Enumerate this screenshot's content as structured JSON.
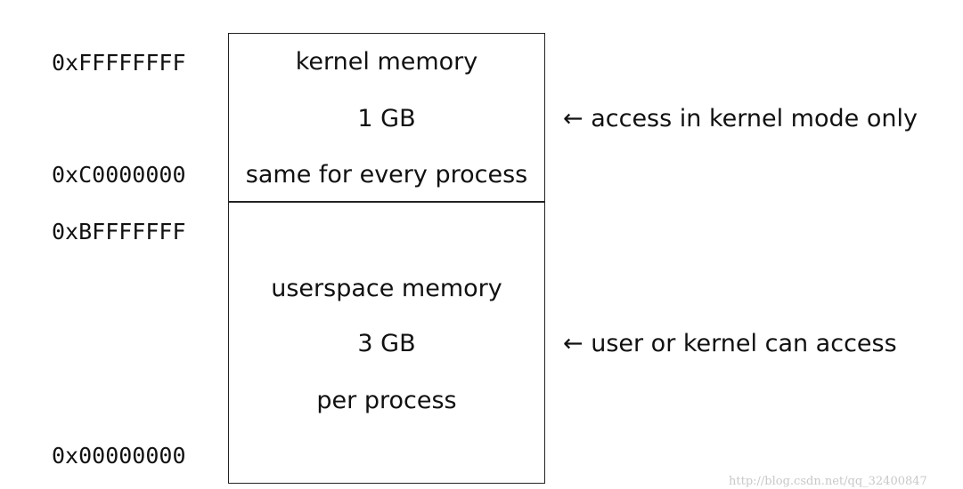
{
  "addresses": {
    "kernel_top": "0xFFFFFFFF",
    "kernel_bottom": "0xC0000000",
    "user_top": "0xBFFFFFFF",
    "user_bottom": "0x00000000"
  },
  "kernel_region": {
    "title": "kernel memory",
    "size": "1 GB",
    "note": "same for every process",
    "access": "← access in kernel mode only"
  },
  "user_region": {
    "title": "userspace memory",
    "size": "3 GB",
    "note": "per process",
    "access": "← user or kernel can access"
  },
  "watermark": "http://blog.csdn.net/qq_32400847"
}
